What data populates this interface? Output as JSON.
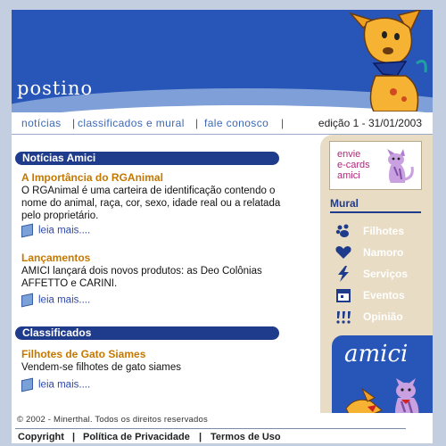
{
  "header": {
    "logo": "postino"
  },
  "topnav": {
    "items": [
      "notícias",
      "classificados e mural",
      "fale conosco"
    ],
    "separator": "|",
    "edition": "edição 1 - 31/01/2003"
  },
  "news": {
    "title": "Notícias Amici",
    "articles": [
      {
        "heading": "A Importância do RGAnimal",
        "body": "O RGAnimal é uma carteira de identificação contendo o nome do animal, raça, cor, sexo, idade real ou a relatada pelo proprietário.",
        "more": "leia mais...."
      },
      {
        "heading": "Lançamentos",
        "body": "AMICI lançará dois novos produtos: as Deo Colônias AFFETTO e CARINI.",
        "more": "leia mais...."
      }
    ]
  },
  "classifieds": {
    "title": "Classificados",
    "articles": [
      {
        "heading": "Filhotes de Gato Siames",
        "body": "Vendem-se filhotes de gato siames",
        "more": "leia mais...."
      }
    ]
  },
  "sidebar": {
    "ecard": "envie\ne-cards\namici",
    "mural_title": "Mural",
    "mural_items": [
      {
        "label": "Filhotes",
        "icon": "paw-icon"
      },
      {
        "label": "Namoro",
        "icon": "heart-icon"
      },
      {
        "label": "Serviços",
        "icon": "lightning-icon"
      },
      {
        "label": "Eventos",
        "icon": "calendar-icon"
      },
      {
        "label": "Opinião",
        "icon": "speech-marks-icon"
      }
    ],
    "amici_logo": "amici"
  },
  "footer": {
    "copyright": "© 2002 - Minerthal. Todos os direitos reservados",
    "links": [
      "Copyright",
      "Política de Privacidade",
      "Termos de Uso"
    ],
    "separator": "|"
  },
  "colors": {
    "brand_blue": "#2856b8",
    "accent_orange": "#c57800",
    "dark_blue": "#1f3b8c",
    "sidebar_beige": "#e8dcc4"
  }
}
